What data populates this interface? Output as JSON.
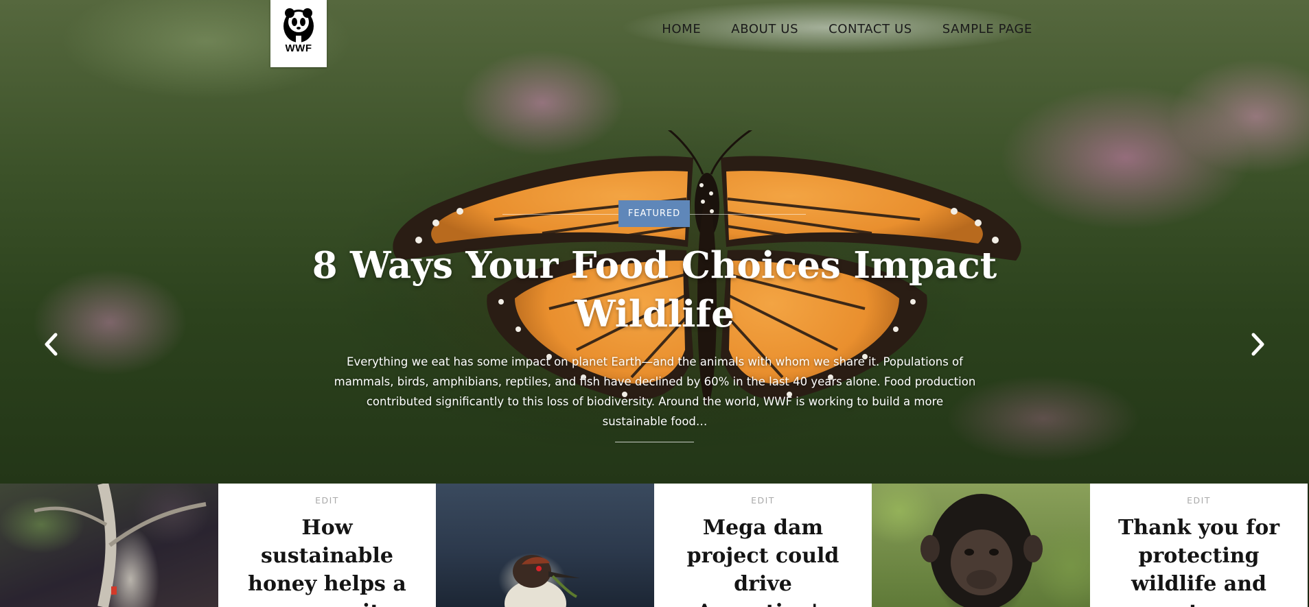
{
  "brand": {
    "logo_text": "WWF"
  },
  "nav": {
    "items": [
      {
        "label": "HOME"
      },
      {
        "label": "ABOUT US"
      },
      {
        "label": "CONTACT US"
      },
      {
        "label": "SAMPLE PAGE"
      }
    ]
  },
  "hero": {
    "badge": "FEATURED",
    "title": "8 Ways Your Food Choices Impact Wildlife",
    "excerpt": "Everything we eat has some impact on planet Earth—and the animals with whom we share it. Populations of mammals, birds, amphibians, reptiles, and fish have declined by 60% in the last 40 years alone. Food production contributed significantly to this loss of biodiversity. Around the world, WWF is working to build a more sustainable food…",
    "prev_icon": "chevron-left-icon",
    "next_icon": "chevron-right-icon"
  },
  "cards": [
    {
      "edit_label": "EDIT",
      "title": "How sustainable honey helps a community"
    },
    {
      "edit_label": "EDIT",
      "title": "Mega dam project could drive Argentina's"
    },
    {
      "edit_label": "EDIT",
      "title": "Thank you for protecting wildlife and nature"
    }
  ],
  "colors": {
    "badge": "#5f87b9",
    "nav_text": "#1a1a1a",
    "card_bg": "#ffffff"
  }
}
